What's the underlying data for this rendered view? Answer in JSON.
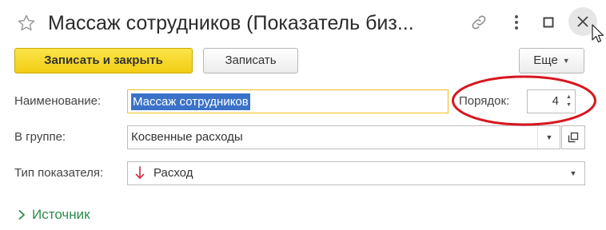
{
  "window": {
    "title": "Массаж сотрудников (Показатель биз...",
    "icons": {
      "favorite": "star-icon",
      "link": "link-icon",
      "more": "more-vertical-icon",
      "maximize": "maximize-icon",
      "close": "close-icon"
    }
  },
  "toolbar": {
    "save_close_label": "Записать и закрыть",
    "save_label": "Записать",
    "more_label": "Еще"
  },
  "form": {
    "name": {
      "label": "Наименование:",
      "value": "Массаж сотрудников"
    },
    "order": {
      "label": "Порядок:",
      "value": "4"
    },
    "group": {
      "label": "В группе:",
      "value": "Косвенные расходы"
    },
    "indicator_type": {
      "label": "Тип показателя:",
      "value": "Расход",
      "icon": "arrow-down-icon"
    }
  },
  "sections": {
    "source": {
      "label": "Источник",
      "expanded": false
    }
  },
  "colors": {
    "primary_button": "#f5d21c",
    "selection": "#3b72c9",
    "source_link": "#2a8c4a",
    "expense_arrow": "#d0334a",
    "annotation": "#d7161f"
  }
}
